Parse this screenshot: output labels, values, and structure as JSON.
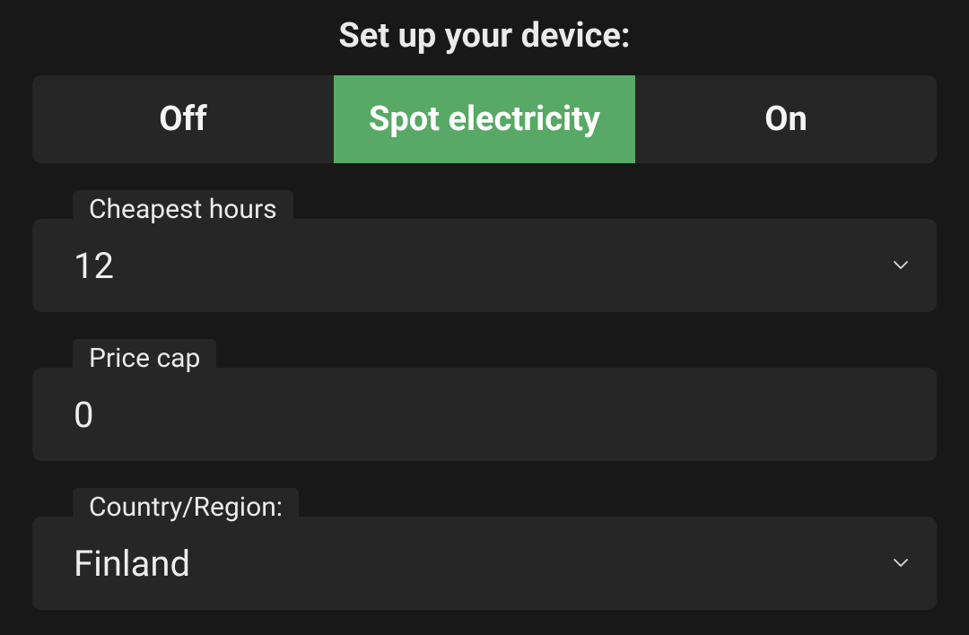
{
  "title": "Set up your device:",
  "segmented": {
    "off": "Off",
    "spot": "Spot electricity",
    "on": "On",
    "active": "spot"
  },
  "fields": {
    "cheapest": {
      "label": "Cheapest hours",
      "value": "12",
      "type": "select"
    },
    "priceCap": {
      "label": "Price cap",
      "value": "0",
      "type": "input"
    },
    "country": {
      "label": "Country/Region:",
      "value": "Finland",
      "type": "select"
    }
  }
}
